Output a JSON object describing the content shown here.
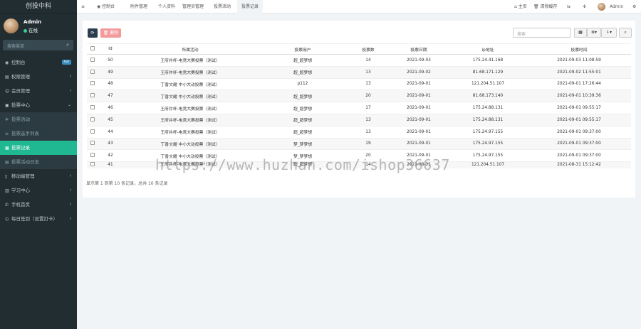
{
  "brand": "创投中科",
  "user": {
    "name": "Admin",
    "status": "在线"
  },
  "sidebar_search": {
    "placeholder": "搜索菜单"
  },
  "menu": [
    {
      "icon": "dashboard-icon",
      "glyph": "◉",
      "label": "控制台",
      "badge": "hot",
      "arrow": ""
    },
    {
      "icon": "folder-icon",
      "glyph": "▤",
      "label": "权限管理",
      "arrow": "‹"
    },
    {
      "icon": "user-icon",
      "glyph": "☺",
      "label": "会员管理",
      "arrow": "‹"
    },
    {
      "icon": "vote-icon",
      "glyph": "▣",
      "label": "投票中心",
      "arrow": "⌄"
    },
    {
      "icon": "gear-icon",
      "glyph": "✲",
      "label": "投票活动",
      "arrow": ""
    },
    {
      "icon": "list-icon",
      "glyph": "≡",
      "label": "投票选手列表",
      "arrow": ""
    },
    {
      "icon": "file-icon",
      "glyph": "▦",
      "label": "投票记录",
      "arrow": ""
    },
    {
      "icon": "doc-icon",
      "glyph": "▤",
      "label": "投票活动日志",
      "arrow": ""
    },
    {
      "icon": "mobile-icon",
      "glyph": "▯",
      "label": "移动端管理",
      "arrow": "‹"
    },
    {
      "icon": "study-icon",
      "glyph": "▥",
      "label": "学习中心",
      "arrow": "‹"
    },
    {
      "icon": "phone-icon",
      "glyph": "✆",
      "label": "手机首页",
      "arrow": "‹"
    },
    {
      "icon": "calendar-icon",
      "glyph": "◷",
      "label": "每日签到（设置打卡）",
      "arrow": "‹"
    }
  ],
  "topbar": {
    "menu_icon": "≡",
    "tabs": [
      "控制台",
      "附件管理",
      "个人资料",
      "管理员管理",
      "投票活动",
      "投票记录"
    ],
    "right": {
      "home": "主页",
      "clear_cache": "清除缓存",
      "admin": "Admin"
    }
  },
  "toolbar": {
    "refresh": "⟳",
    "delete": "删除",
    "search_placeholder": "搜索"
  },
  "table": {
    "columns": [
      "Id",
      "所属活动",
      "投票用户",
      "投票数",
      "投票日期",
      "ip地址",
      "投票时间"
    ],
    "rows": [
      {
        "id": "50",
        "activity": "王府井杯-电竞大赛投票（测试）",
        "user": "超_超梦想",
        "votes": "14",
        "date": "2021-09-03",
        "ip": "175.24.41.168",
        "time": "2021-09-03 11:08:59"
      },
      {
        "id": "49",
        "activity": "王府井杯-电竞大赛投票（测试）",
        "user": "超_超梦想",
        "votes": "13",
        "date": "2021-09-02",
        "ip": "81.68.171.129",
        "time": "2021-09-02 11:55:01"
      },
      {
        "id": "48",
        "activity": "丁香文耀 中小大动投票（测试）",
        "user": "p112",
        "votes": "13",
        "date": "2021-09-01",
        "ip": "121.204.51.107",
        "time": "2021-09-01 17:26:44"
      },
      {
        "id": "47",
        "activity": "丁香文耀 中小大动投票（测试）",
        "user": "超_超梦想",
        "votes": "20",
        "date": "2021-09-01",
        "ip": "81.68.173.140",
        "time": "2021-09-01 10:39:36"
      },
      {
        "id": "46",
        "activity": "王府井杯-电竞大赛投票（测试）",
        "user": "超_超梦想",
        "votes": "17",
        "date": "2021-09-01",
        "ip": "175.24.88.131",
        "time": "2021-09-01 09:55:17"
      },
      {
        "id": "45",
        "activity": "王府井杯-电竞大赛投票（测试）",
        "user": "超_超梦想",
        "votes": "13",
        "date": "2021-09-01",
        "ip": "175.24.88.131",
        "time": "2021-09-01 09:55:17"
      },
      {
        "id": "44",
        "activity": "王府井杯-电竞大赛投票（测试）",
        "user": "超_超梦想",
        "votes": "13",
        "date": "2021-09-01",
        "ip": "175.24.97.155",
        "time": "2021-09-01 09:37:00"
      },
      {
        "id": "43",
        "activity": "丁香文耀 中小大动投票（测试）",
        "user": "梦_梦梦想",
        "votes": "19",
        "date": "2021-09-01",
        "ip": "175.24.97.155",
        "time": "2021-09-01 09:37:00"
      },
      {
        "id": "42",
        "activity": "丁香文耀 中小大动投票（测试）",
        "user": "梦_梦梦想",
        "votes": "20",
        "date": "2021-09-01",
        "ip": "175.24.97.155",
        "time": "2021-09-01 09:37:00"
      },
      {
        "id": "41",
        "activity": "王府井杯-电竞大赛投票（测试）",
        "user": "超_超梦想",
        "votes": "14",
        "date": "2021-08-31",
        "ip": "121.204.51.107",
        "time": "2021-08-31 15:12:42"
      }
    ]
  },
  "summary": "显示第 1 到第 10 条记录，总共 10 条记录",
  "watermark": "https://www.huzhan.com/ishop36637"
}
